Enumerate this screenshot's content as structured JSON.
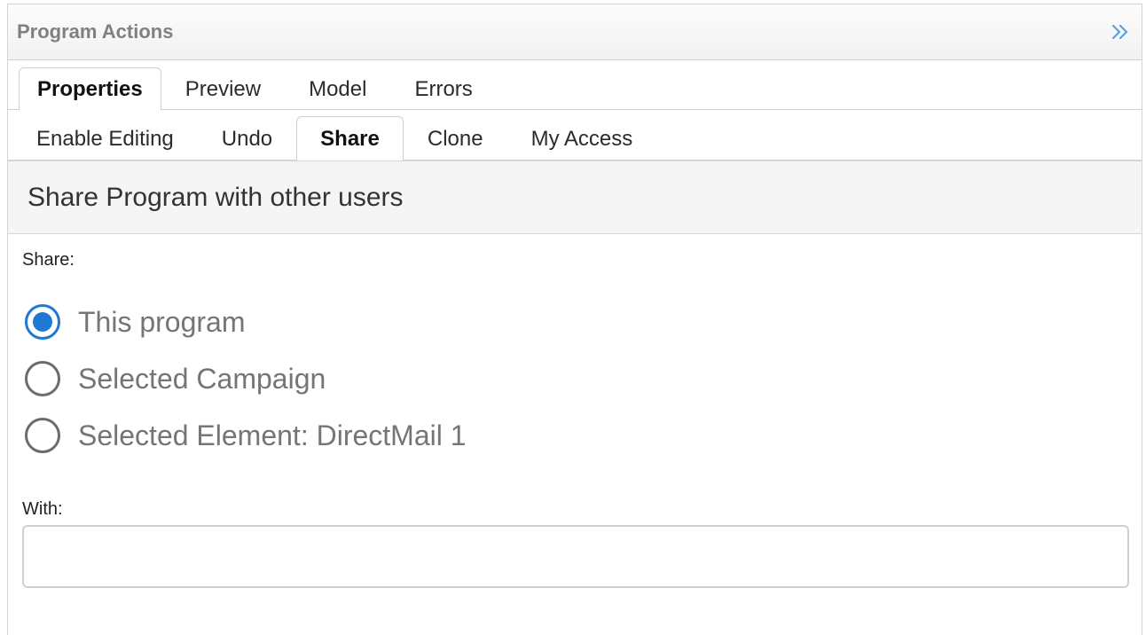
{
  "panel": {
    "title": "Program Actions",
    "collapse_icon": "double-chevron-right-icon"
  },
  "primary_tabs": [
    {
      "label": "Properties",
      "active": true
    },
    {
      "label": "Preview",
      "active": false
    },
    {
      "label": "Model",
      "active": false
    },
    {
      "label": "Errors",
      "active": false
    }
  ],
  "secondary_tabs": [
    {
      "label": "Enable Editing",
      "active": false
    },
    {
      "label": "Undo",
      "active": false
    },
    {
      "label": "Share",
      "active": true
    },
    {
      "label": "Clone",
      "active": false
    },
    {
      "label": "My Access",
      "active": false
    }
  ],
  "share_form": {
    "heading": "Share Program with other users",
    "share_label": "Share:",
    "options": [
      {
        "label": "This program",
        "checked": true
      },
      {
        "label": "Selected Campaign",
        "checked": false
      },
      {
        "label": "Selected Element: DirectMail 1",
        "checked": false
      }
    ],
    "with_label": "With:",
    "with_value": "",
    "with_placeholder": ""
  },
  "colors": {
    "accent": "#1f78d1",
    "radio_border": "#6c6c6c",
    "title_gray": "#808080"
  }
}
